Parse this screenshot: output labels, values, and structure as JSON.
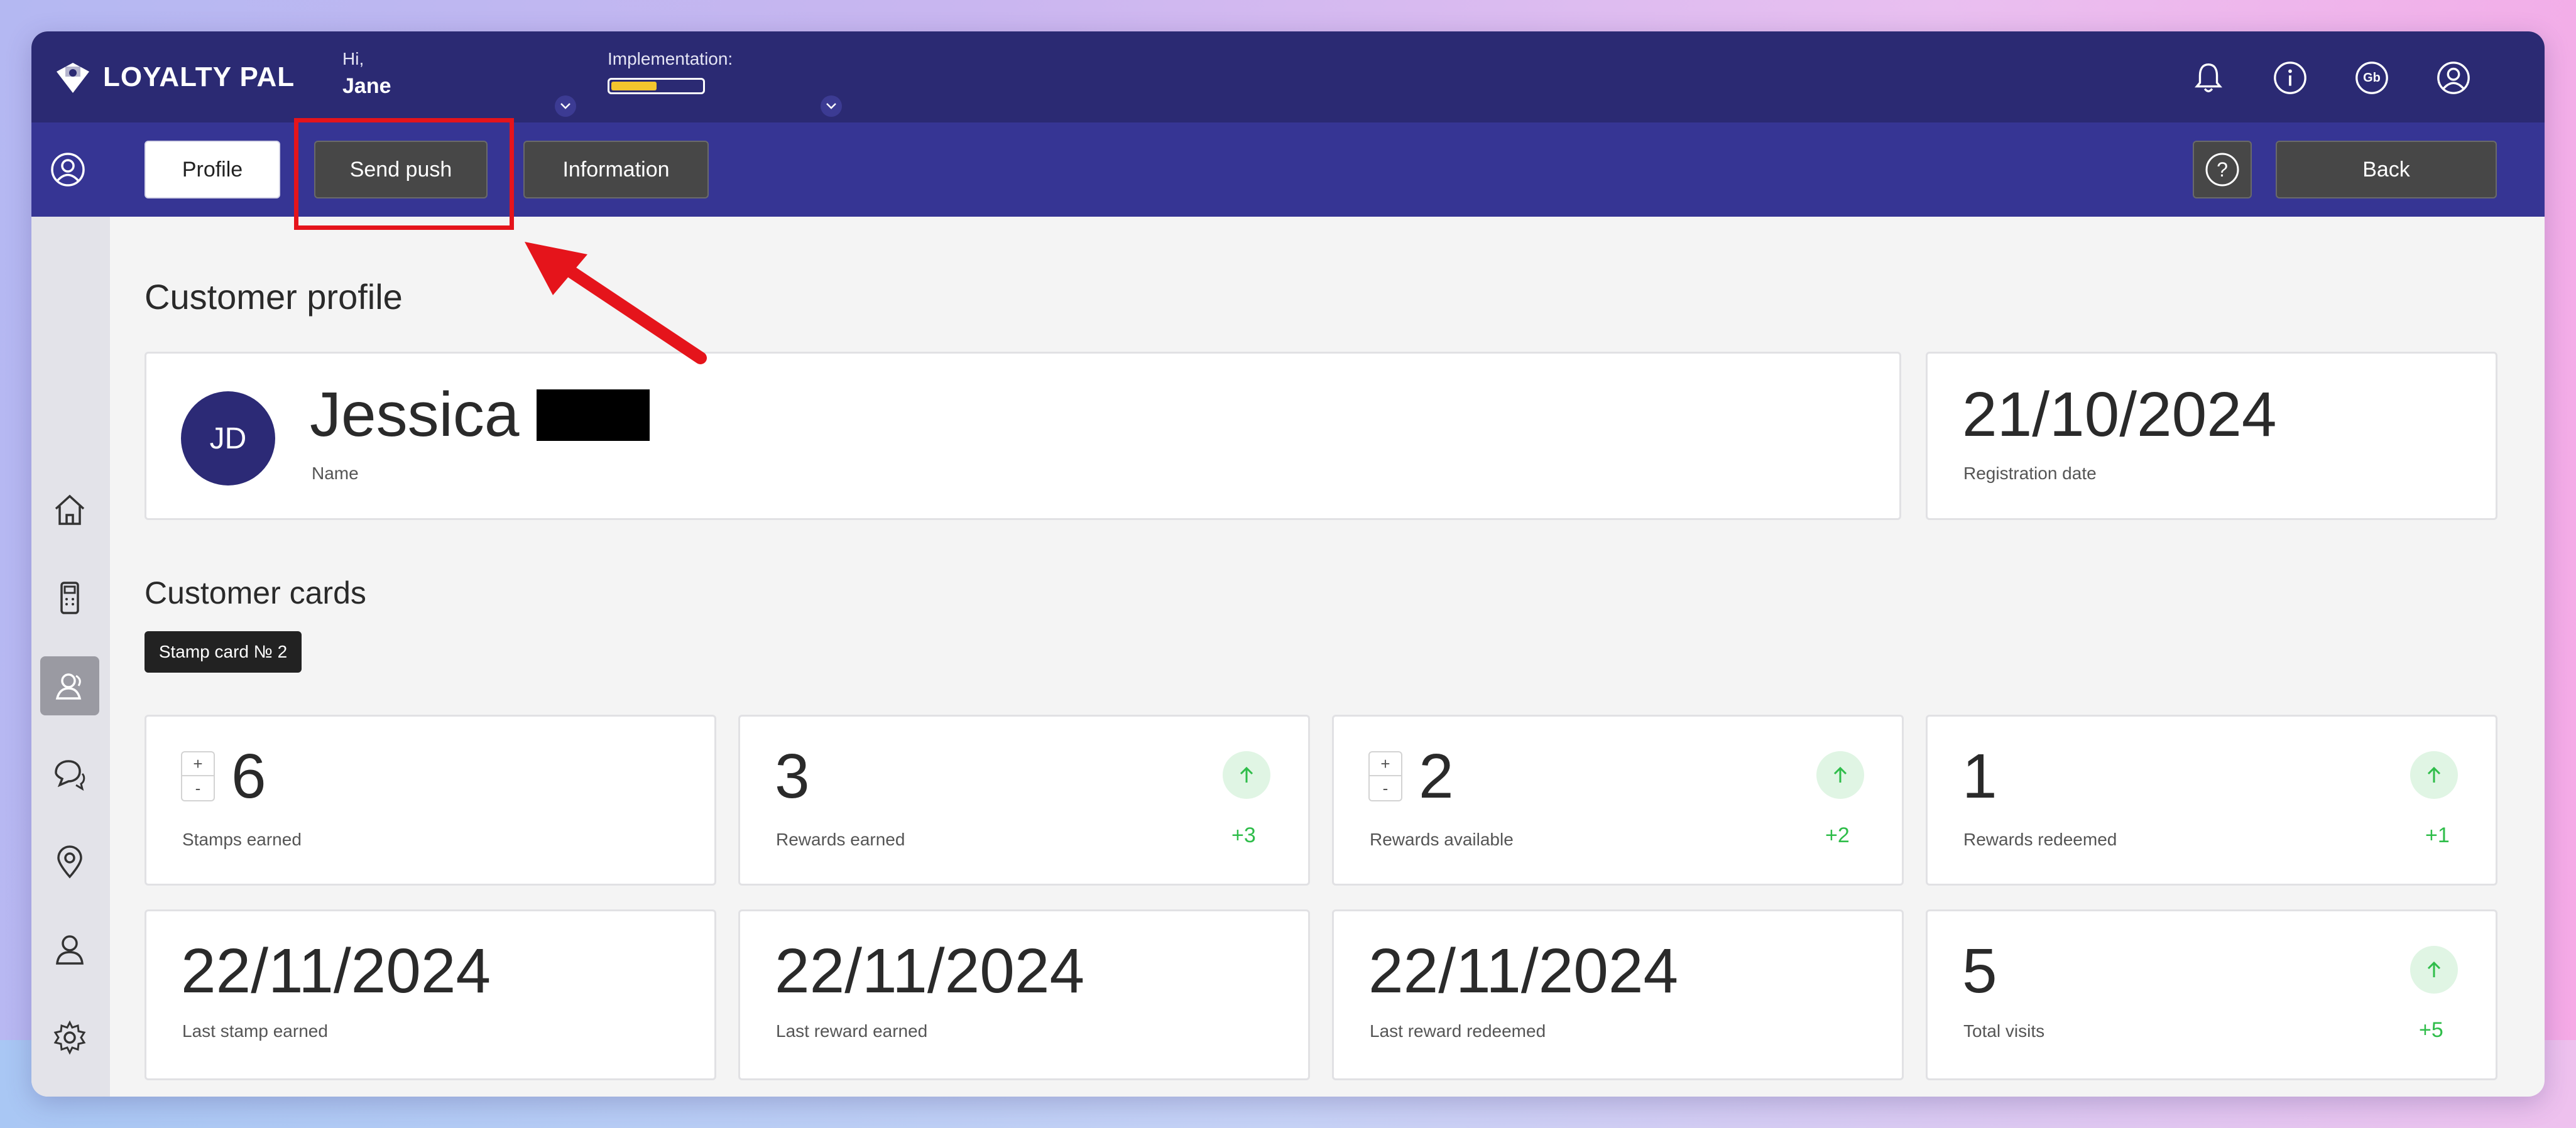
{
  "app": {
    "logo_text": "LOYALTY PAL"
  },
  "header": {
    "greeting": "Hi,",
    "user_name": "Jane",
    "implementation_label": "Implementation:",
    "implementation_progress": 0.5,
    "language_badge": "Gb"
  },
  "toolbar": {
    "profile": "Profile",
    "send_push": "Send push",
    "information": "Information",
    "help": "?",
    "back": "Back"
  },
  "profile": {
    "section_title": "Customer profile",
    "avatar_initials": "JD",
    "name": "Jessica",
    "name_label": "Name",
    "registration_date": "21/10/2024",
    "registration_label": "Registration date"
  },
  "cards": {
    "section_title": "Customer cards",
    "chip_label": "Stamp card № 2",
    "stamps_earned": {
      "value": "6",
      "label": "Stamps earned"
    },
    "rewards_earned": {
      "value": "3",
      "label": "Rewards earned",
      "delta": "+3"
    },
    "rewards_available": {
      "value": "2",
      "label": "Rewards available",
      "delta": "+2"
    },
    "rewards_redeemed": {
      "value": "1",
      "label": "Rewards redeemed",
      "delta": "+1"
    },
    "last_stamp": {
      "value": "22/11/2024",
      "label": "Last stamp earned"
    },
    "last_reward": {
      "value": "22/11/2024",
      "label": "Last reward earned"
    },
    "last_redeemed": {
      "value": "22/11/2024",
      "label": "Last reward redeemed"
    },
    "total_visits": {
      "value": "5",
      "label": "Total visits",
      "delta": "+5"
    },
    "stepper_plus": "+",
    "stepper_minus": "-"
  },
  "colors": {
    "header": "#2b2a73",
    "toolbar": "#363594",
    "highlight": "#e5141b",
    "positive": "#2fbd4a"
  }
}
